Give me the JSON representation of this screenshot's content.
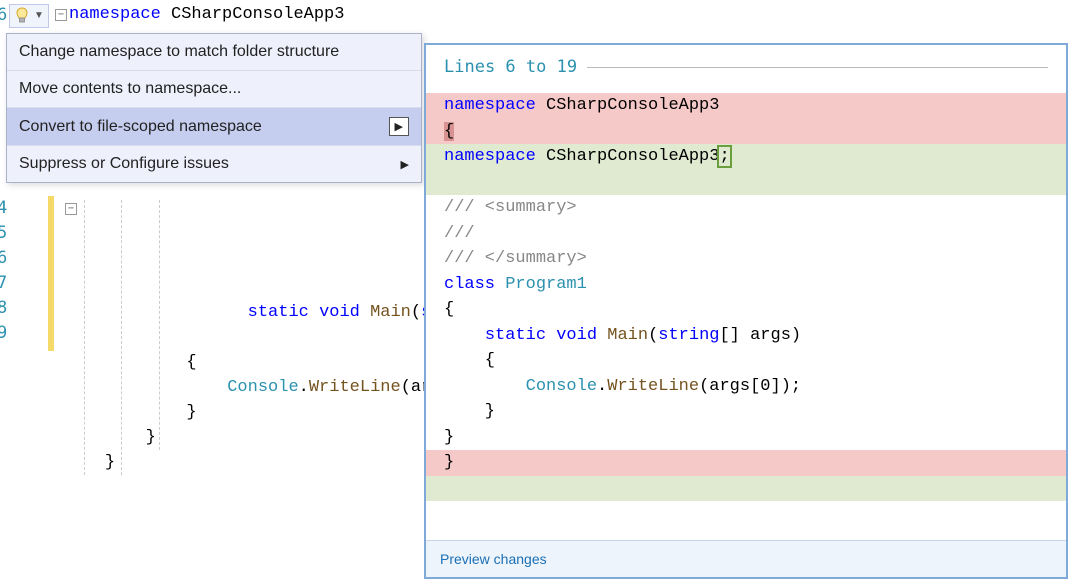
{
  "lineNumbers": {
    "l0": "6",
    "l1": "7",
    "l2": "8",
    "l3": "9",
    "l4": "4",
    "l5": "5",
    "l6": "6",
    "l7": "7",
    "l8": "8",
    "l9": "9"
  },
  "firstLine": {
    "kw": "namespace",
    "name": "CSharpConsoleApp3"
  },
  "menu": {
    "item1": "Change namespace to match folder structure",
    "item2": "Move contents to namespace...",
    "item3": "Convert to file-scoped namespace",
    "item4": "Suppress or Configure issues"
  },
  "editor": {
    "l1_kw": "static",
    "l1_void": "void",
    "l1_method": "Main",
    "l1_type": "string",
    "l2": "{",
    "l3_class": "Console",
    "l3_dot": ".",
    "l3_call": "WriteLine",
    "l3_open": "(",
    "l3_arg": "ar",
    "l4": "}",
    "l5": "}",
    "l6": "}"
  },
  "preview": {
    "header": "Lines 6 to 19",
    "kw_ns": "namespace",
    "name": "CSharpConsoleApp3",
    "brace": "{",
    "semi": ";",
    "sum1": "/// <summary>",
    "sum2": "///",
    "sum3": "/// </summary>",
    "kw_class": "class",
    "class_name": "Program1",
    "kw_static": "static",
    "kw_void": "void",
    "method": "Main",
    "kw_string": "string",
    "brackets": "[]",
    "args": "args",
    "console": "Console",
    "writeln": "WriteLine",
    "argexpr": "args[0]",
    "close": "}",
    "footer": "Preview changes"
  }
}
